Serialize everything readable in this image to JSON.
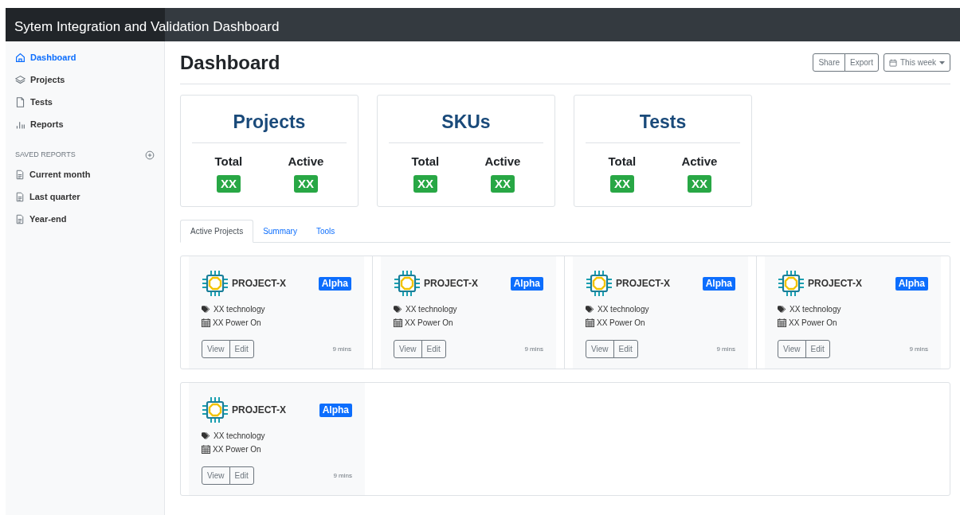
{
  "header": {
    "title": "Sytem Integration and Validation Dashboard"
  },
  "sidebar": {
    "items": [
      {
        "label": "Dashboard",
        "selected": true
      },
      {
        "label": "Projects",
        "selected": false
      },
      {
        "label": "Tests",
        "selected": false
      },
      {
        "label": "Reports",
        "selected": false
      }
    ],
    "saved_reports": {
      "heading": "SAVED REPORTS",
      "items": [
        {
          "label": "Current month"
        },
        {
          "label": "Last quarter"
        },
        {
          "label": "Year-end"
        }
      ]
    }
  },
  "page": {
    "title": "Dashboard",
    "actions": [
      "Share",
      "Export"
    ],
    "range": "This week"
  },
  "stats": [
    {
      "title": "Projects",
      "total_label": "Total",
      "total": "XX",
      "active_label": "Active",
      "active": "XX"
    },
    {
      "title": "SKUs",
      "total_label": "Total",
      "total": "XX",
      "active_label": "Active",
      "active": "XX"
    },
    {
      "title": "Tests",
      "total_label": "Total",
      "total": "XX",
      "active_label": "Active",
      "active": "XX"
    }
  ],
  "tabs": [
    {
      "label": "Active Projects",
      "selected": true
    },
    {
      "label": "Summary",
      "selected": false
    },
    {
      "label": "Tools",
      "selected": false
    }
  ],
  "projects": [
    {
      "name": "PROJECT-X",
      "badge": "Alpha",
      "technology": "XX technology",
      "milestone": "XX Power On",
      "buttons": [
        "View",
        "Edit"
      ],
      "time": "9 mins"
    },
    {
      "name": "PROJECT-X",
      "badge": "Alpha",
      "technology": "XX technology",
      "milestone": "XX Power On",
      "buttons": [
        "View",
        "Edit"
      ],
      "time": "9 mins"
    },
    {
      "name": "PROJECT-X",
      "badge": "Alpha",
      "technology": "XX technology",
      "milestone": "XX Power On",
      "buttons": [
        "View",
        "Edit"
      ],
      "time": "9 mins"
    },
    {
      "name": "PROJECT-X",
      "badge": "Alpha",
      "technology": "XX technology",
      "milestone": "XX Power On",
      "buttons": [
        "View",
        "Edit"
      ],
      "time": "9 mins"
    },
    {
      "name": "PROJECT-X",
      "badge": "Alpha",
      "technology": "XX technology",
      "milestone": "XX Power On",
      "buttons": [
        "View",
        "Edit"
      ],
      "time": "9 mins"
    }
  ]
}
